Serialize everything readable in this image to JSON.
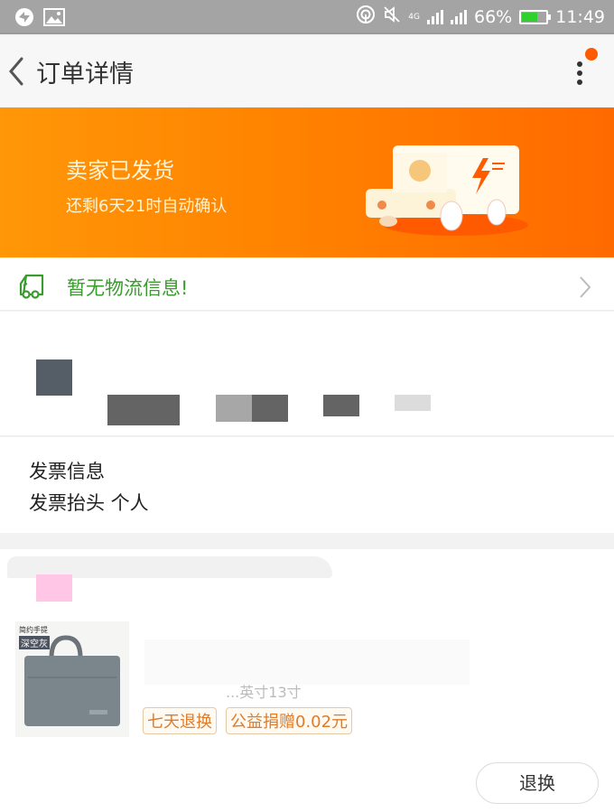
{
  "status_bar": {
    "left_icons": [
      "sync-app-icon",
      "gallery-icon"
    ],
    "right_icons": [
      "hotspot-icon",
      "mute-icon",
      "lte-signal-icon",
      "signal-icon",
      "battery-icon"
    ],
    "network_label": "4G",
    "battery_percent": "66%",
    "battery_level": 0.66,
    "battery_color": "#2ed12e",
    "time": "11:49"
  },
  "header": {
    "title": "订单详情",
    "back_icon": "chevron-left-icon",
    "more_icon": "more-vertical-icon",
    "has_notification_dot": true,
    "accent": "#ff5a00"
  },
  "banner": {
    "title": "卖家已发货",
    "subtitle": "还剩6天21时自动确认",
    "illustration": "delivery-truck-illustration",
    "gradient_start": "#ff9708",
    "gradient_end": "#ff6a00"
  },
  "logistics": {
    "icon": "truck-icon",
    "text": "暂无物流信息!",
    "color": "#3a9b2e",
    "chevron_icon": "chevron-right-icon"
  },
  "address": {
    "redacted": true
  },
  "invoice": {
    "title": "发票信息",
    "header_line": "发票抬头 个人"
  },
  "order": {
    "shop_redacted": true,
    "product": {
      "thumb_caption_1": "简约手提",
      "thumb_caption_2": "深空灰",
      "title_redacted": true,
      "sku_partial": "...英寸13寸"
    },
    "tags": [
      "七天退换",
      "公益捐赠0.02元"
    ],
    "actions": {
      "return_label": "退换"
    }
  }
}
